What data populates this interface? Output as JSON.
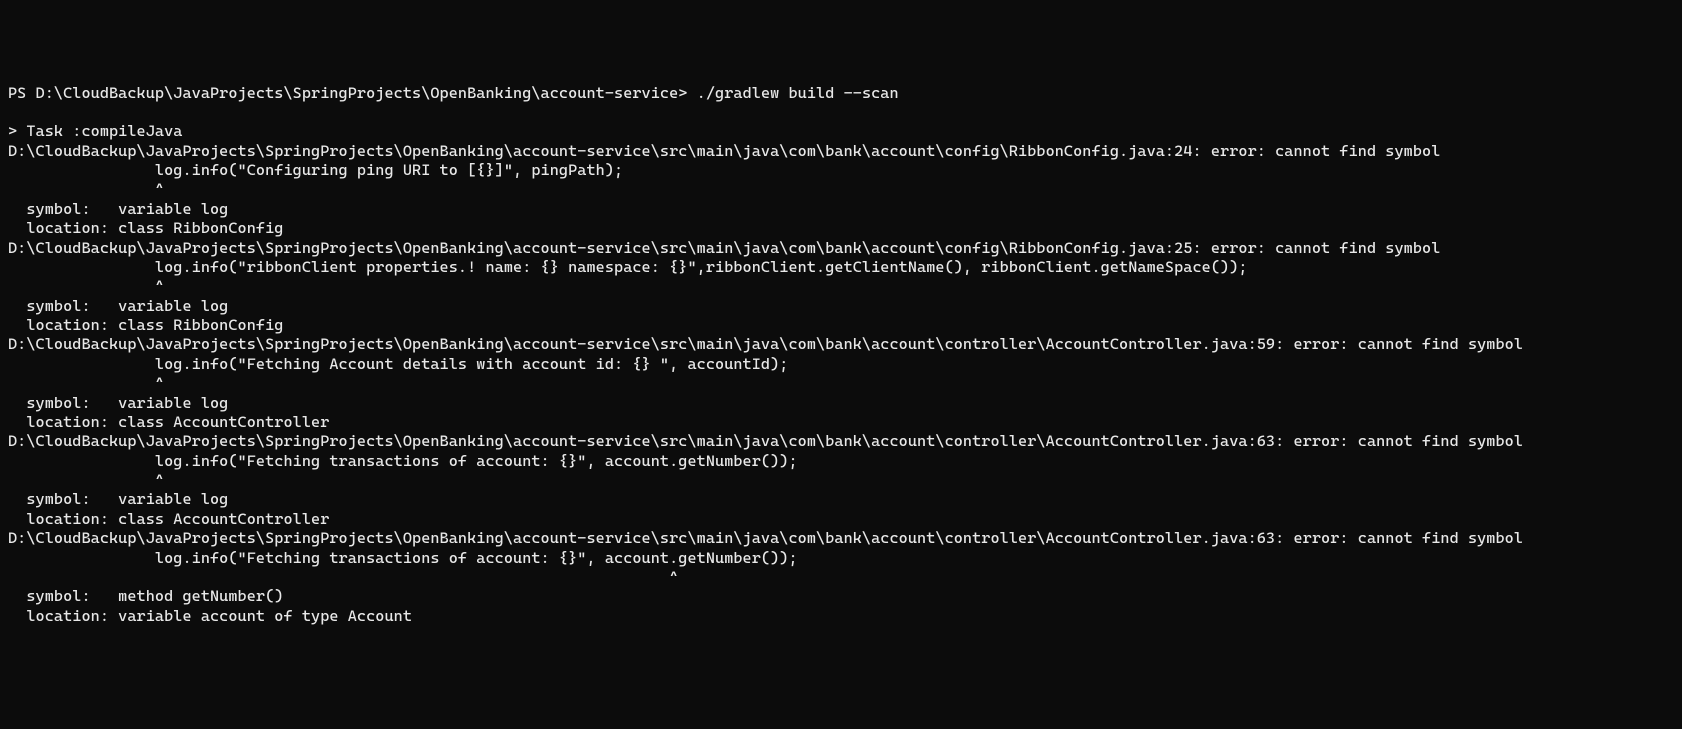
{
  "prompt": {
    "ps": "PS ",
    "path": "D:\\CloudBackup\\JavaProjects\\SpringProjects\\OpenBanking\\account-service",
    "arrow": "> ",
    "command": "./gradlew build --scan"
  },
  "output": {
    "lines": [
      "",
      "> Task :compileJava",
      "D:\\CloudBackup\\JavaProjects\\SpringProjects\\OpenBanking\\account-service\\src\\main\\java\\com\\bank\\account\\config\\RibbonConfig.java:24: error: cannot find symbol",
      "                log.info(\"Configuring ping URI to [{}]\", pingPath);",
      "                ^",
      "  symbol:   variable log",
      "  location: class RibbonConfig",
      "D:\\CloudBackup\\JavaProjects\\SpringProjects\\OpenBanking\\account-service\\src\\main\\java\\com\\bank\\account\\config\\RibbonConfig.java:25: error: cannot find symbol",
      "                log.info(\"ribbonClient properties.! name: {} namespace: {}\",ribbonClient.getClientName(), ribbonClient.getNameSpace());",
      "                ^",
      "  symbol:   variable log",
      "  location: class RibbonConfig",
      "D:\\CloudBackup\\JavaProjects\\SpringProjects\\OpenBanking\\account-service\\src\\main\\java\\com\\bank\\account\\controller\\AccountController.java:59: error: cannot find symbol",
      "                log.info(\"Fetching Account details with account id: {} \", accountId);",
      "                ^",
      "  symbol:   variable log",
      "  location: class AccountController",
      "D:\\CloudBackup\\JavaProjects\\SpringProjects\\OpenBanking\\account-service\\src\\main\\java\\com\\bank\\account\\controller\\AccountController.java:63: error: cannot find symbol",
      "                log.info(\"Fetching transactions of account: {}\", account.getNumber());",
      "                ^",
      "  symbol:   variable log",
      "  location: class AccountController",
      "D:\\CloudBackup\\JavaProjects\\SpringProjects\\OpenBanking\\account-service\\src\\main\\java\\com\\bank\\account\\controller\\AccountController.java:63: error: cannot find symbol",
      "                log.info(\"Fetching transactions of account: {}\", account.getNumber());",
      "                                                                        ^",
      "  symbol:   method getNumber()",
      "  location: variable account of type Account"
    ]
  }
}
